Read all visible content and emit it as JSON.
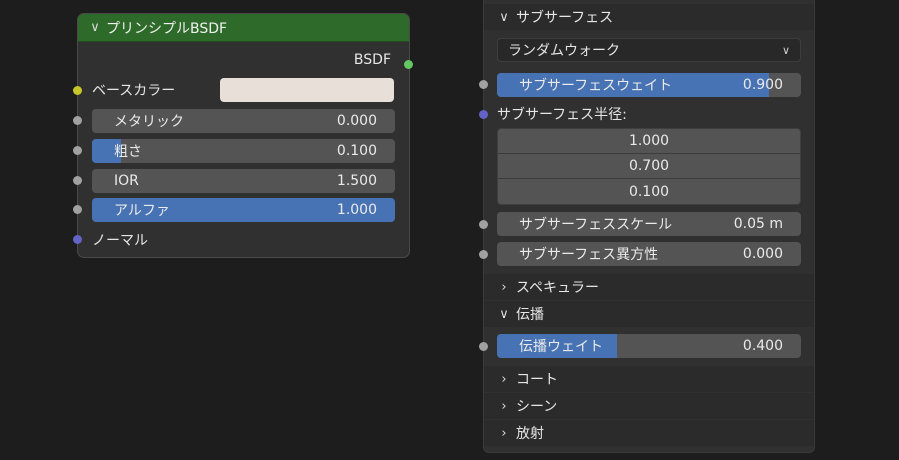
{
  "node": {
    "title": "プリンシプルBSDF",
    "output_label": "BSDF",
    "base_color_label": "ベースカラー",
    "base_color_swatch": "#e8dfd9",
    "metallic": {
      "label": "メタリック",
      "value": "0.000"
    },
    "roughness": {
      "label": "粗さ",
      "value": "0.100",
      "fraction": 0.1
    },
    "ior": {
      "label": "IOR",
      "value": "1.500"
    },
    "alpha": {
      "label": "アルファ",
      "value": "1.000",
      "fraction": 1.0
    },
    "normal_label": "ノーマル"
  },
  "panel": {
    "subsurface": {
      "header": "サブサーフェス",
      "method": "ランダムウォーク",
      "weight": {
        "label": "サブサーフェスウェイト",
        "value": "0.900",
        "fraction": 0.9
      },
      "radius_label": "サブサーフェス半径:",
      "radius": [
        "1.000",
        "0.700",
        "0.100"
      ],
      "scale": {
        "label": "サブサーフェススケール",
        "value": "0.05 m"
      },
      "anisotropy": {
        "label": "サブサーフェス異方性",
        "value": "0.000"
      }
    },
    "specular": {
      "header": "スペキュラー"
    },
    "transmission": {
      "header": "伝播",
      "weight": {
        "label": "伝播ウェイト",
        "value": "0.400",
        "fraction": 0.4
      }
    },
    "coat": {
      "header": "コート"
    },
    "sheen": {
      "header": "シーン"
    },
    "emission": {
      "header": "放射"
    }
  },
  "colors": {
    "header_green": "#2e6b2a",
    "accent_blue": "#4772b3",
    "socket_yellow": "#c7c729",
    "socket_gray": "#a1a1a1",
    "socket_purple": "#6363c7",
    "socket_green": "#63c763"
  }
}
